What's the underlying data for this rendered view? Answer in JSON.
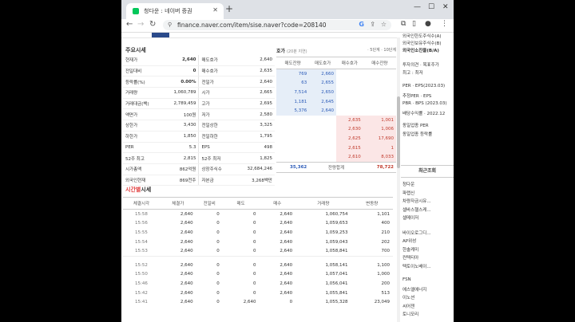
{
  "browser": {
    "tab_title": "청다운 : 네이버 증권",
    "url": "finance.naver.com/item/sise.naver?code=208140"
  },
  "quote": {
    "title": "주요시세",
    "rows": [
      [
        "현재가",
        "2,640",
        "매도호가",
        "2,640"
      ],
      [
        "전일대비",
        "0",
        "매수호가",
        "2,635"
      ],
      [
        "등락률(%)",
        "0.00%",
        "전일가",
        "2,640"
      ],
      [
        "거래량",
        "1,060,789",
        "시가",
        "2,665"
      ],
      [
        "거래대금(백)",
        "2,789,459",
        "고가",
        "2,695"
      ],
      [
        "액면가",
        "100원",
        "저가",
        "2,580"
      ],
      [
        "상한가",
        "3,430",
        "전일상한",
        "3,325"
      ],
      [
        "하한가",
        "1,850",
        "전일하한",
        "1,795"
      ],
      [
        "PER",
        "5.3",
        "EPS",
        "498"
      ],
      [
        "52주 최고",
        "2,815",
        "52주 최저",
        "1,825"
      ],
      [
        "시가총액",
        "862억원",
        "상장주식수",
        "32,684,246"
      ],
      [
        "외국인현재",
        "869천주",
        "자본금",
        "3,268백만"
      ]
    ]
  },
  "hoga": {
    "title": "호가",
    "subtitle": "(20분 지연)",
    "right": "· 5단계 · 10단계",
    "headers": [
      "매도잔량",
      "매도호가",
      "매수호가",
      "매수잔량"
    ],
    "asks": [
      [
        "769",
        "2,660"
      ],
      [
        "63",
        "2,655"
      ],
      [
        "7,514",
        "2,650"
      ],
      [
        "1,181",
        "2,645"
      ],
      [
        "5,376",
        "2,640"
      ]
    ],
    "bids": [
      [
        "2,635",
        "1,001"
      ],
      [
        "2,630",
        "1,006"
      ],
      [
        "2,625",
        "17,690"
      ],
      [
        "2,615",
        "1"
      ],
      [
        "2,610",
        "8,033"
      ]
    ],
    "summary": {
      "ask_total": "35,362",
      "label": "잔량합계",
      "bid_total": "78,722"
    }
  },
  "daily": {
    "title_red": "시간별",
    "title_black": "시세",
    "headers": [
      "체결시각",
      "체결가",
      "전일비",
      "매도",
      "매수",
      "거래량",
      "변동량"
    ],
    "group1": [
      [
        "15:58",
        "2,640",
        "0",
        "0",
        "2,640",
        "1,060,754",
        "1,101"
      ],
      [
        "15:56",
        "2,640",
        "0",
        "0",
        "2,640",
        "1,059,653",
        "400"
      ],
      [
        "15:55",
        "2,640",
        "0",
        "0",
        "2,640",
        "1,059,253",
        "210"
      ],
      [
        "15:54",
        "2,640",
        "0",
        "0",
        "2,640",
        "1,059,043",
        "202"
      ],
      [
        "15:53",
        "2,640",
        "0",
        "0",
        "2,640",
        "1,058,841",
        "700"
      ]
    ],
    "group2": [
      [
        "15:52",
        "2,640",
        "0",
        "0",
        "2,640",
        "1,058,141",
        "1,100"
      ],
      [
        "15:50",
        "2,640",
        "0",
        "0",
        "2,640",
        "1,057,041",
        "1,000"
      ],
      [
        "15:46",
        "2,640",
        "0",
        "0",
        "2,640",
        "1,056,041",
        "200"
      ],
      [
        "15:42",
        "2,640",
        "0",
        "0",
        "2,640",
        "1,055,841",
        "513"
      ],
      [
        "15:41",
        "2,640",
        "0",
        "2,640",
        "0",
        "1,055,328",
        "23,049"
      ]
    ]
  },
  "side": {
    "top": [
      "외국인한도주식수(A)",
      "외국인보유주식수(B)",
      "외국인소진율(B/A)"
    ],
    "mid": [
      "투자의견 · 목표주가",
      "최고 : 최저"
    ],
    "per": [
      "PER · EPS(2023.03)",
      "추정PER · EPS",
      "PBR · BPS (2023.03)",
      "배당수익률 · 2022.12"
    ],
    "sector": [
      "동일업종 PER",
      "동일업종 등락률"
    ],
    "recent_title": "최근조회",
    "recent": [
      "청다운",
      "파랩신",
      "차량자금시유...",
      "셀바스헬스케...",
      "셀메이저",
      "바이오로그디...",
      "AP위성",
      "한솔케미",
      "컨텍티아",
      "텍토이노베이...",
      "FSN",
      "에스엘에너지",
      "이노션",
      "씨어젠",
      "토니모리"
    ]
  }
}
